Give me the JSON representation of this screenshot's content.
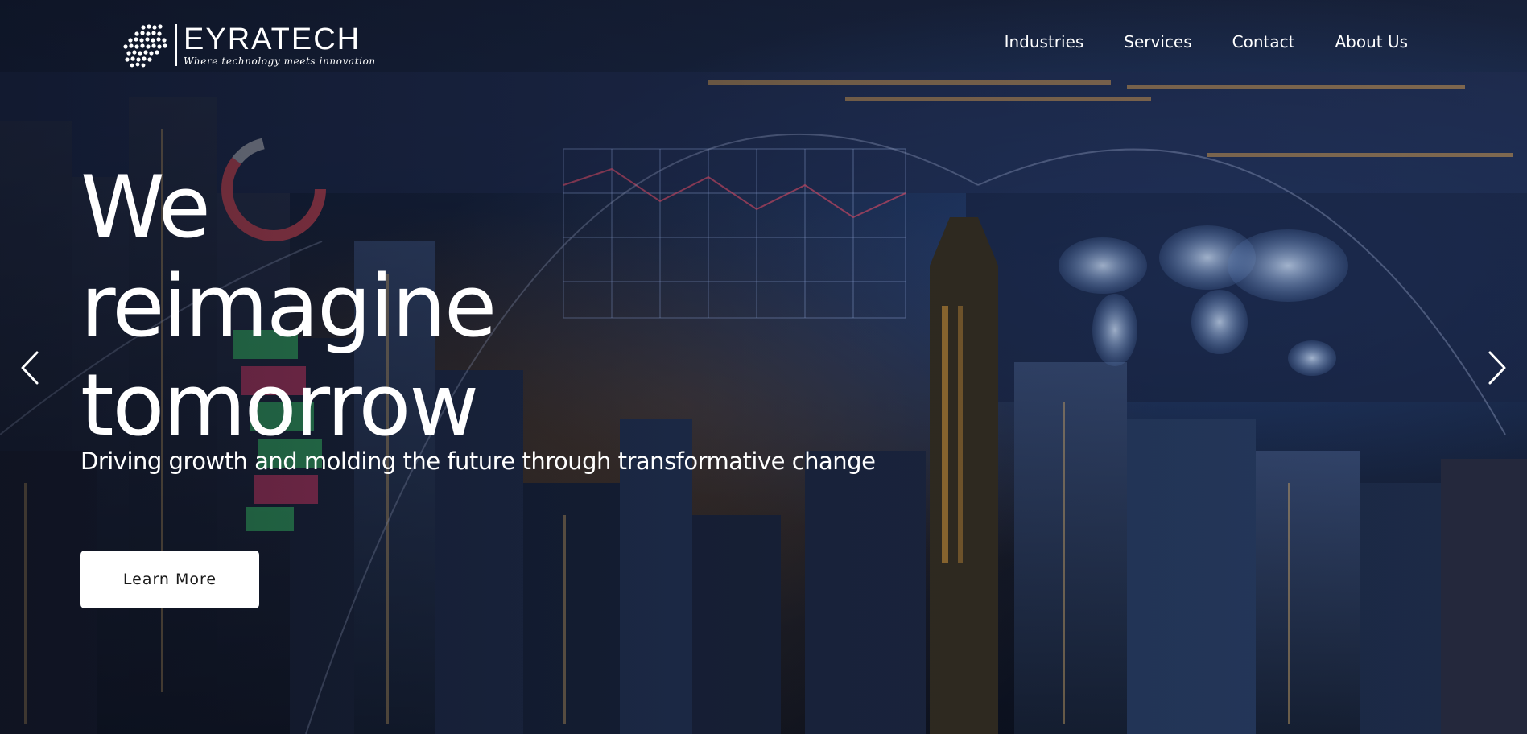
{
  "header": {
    "logo_name": "EYRATECH",
    "logo_tagline": "Where technology meets innovation",
    "nav": [
      {
        "label": "Industries"
      },
      {
        "label": "Services"
      },
      {
        "label": "Contact"
      },
      {
        "label": "About Us"
      }
    ]
  },
  "hero": {
    "headline_lines": [
      "We",
      "reimagine",
      "tomorrow"
    ],
    "subheadline": "Driving growth and molding the future through transformative change",
    "cta_label": "Learn More",
    "prev_icon": "chevron-left-icon",
    "next_icon": "chevron-right-icon"
  },
  "colors": {
    "text": "#ffffff",
    "cta_background": "#ffffff",
    "cta_text": "#1a1a1a"
  }
}
